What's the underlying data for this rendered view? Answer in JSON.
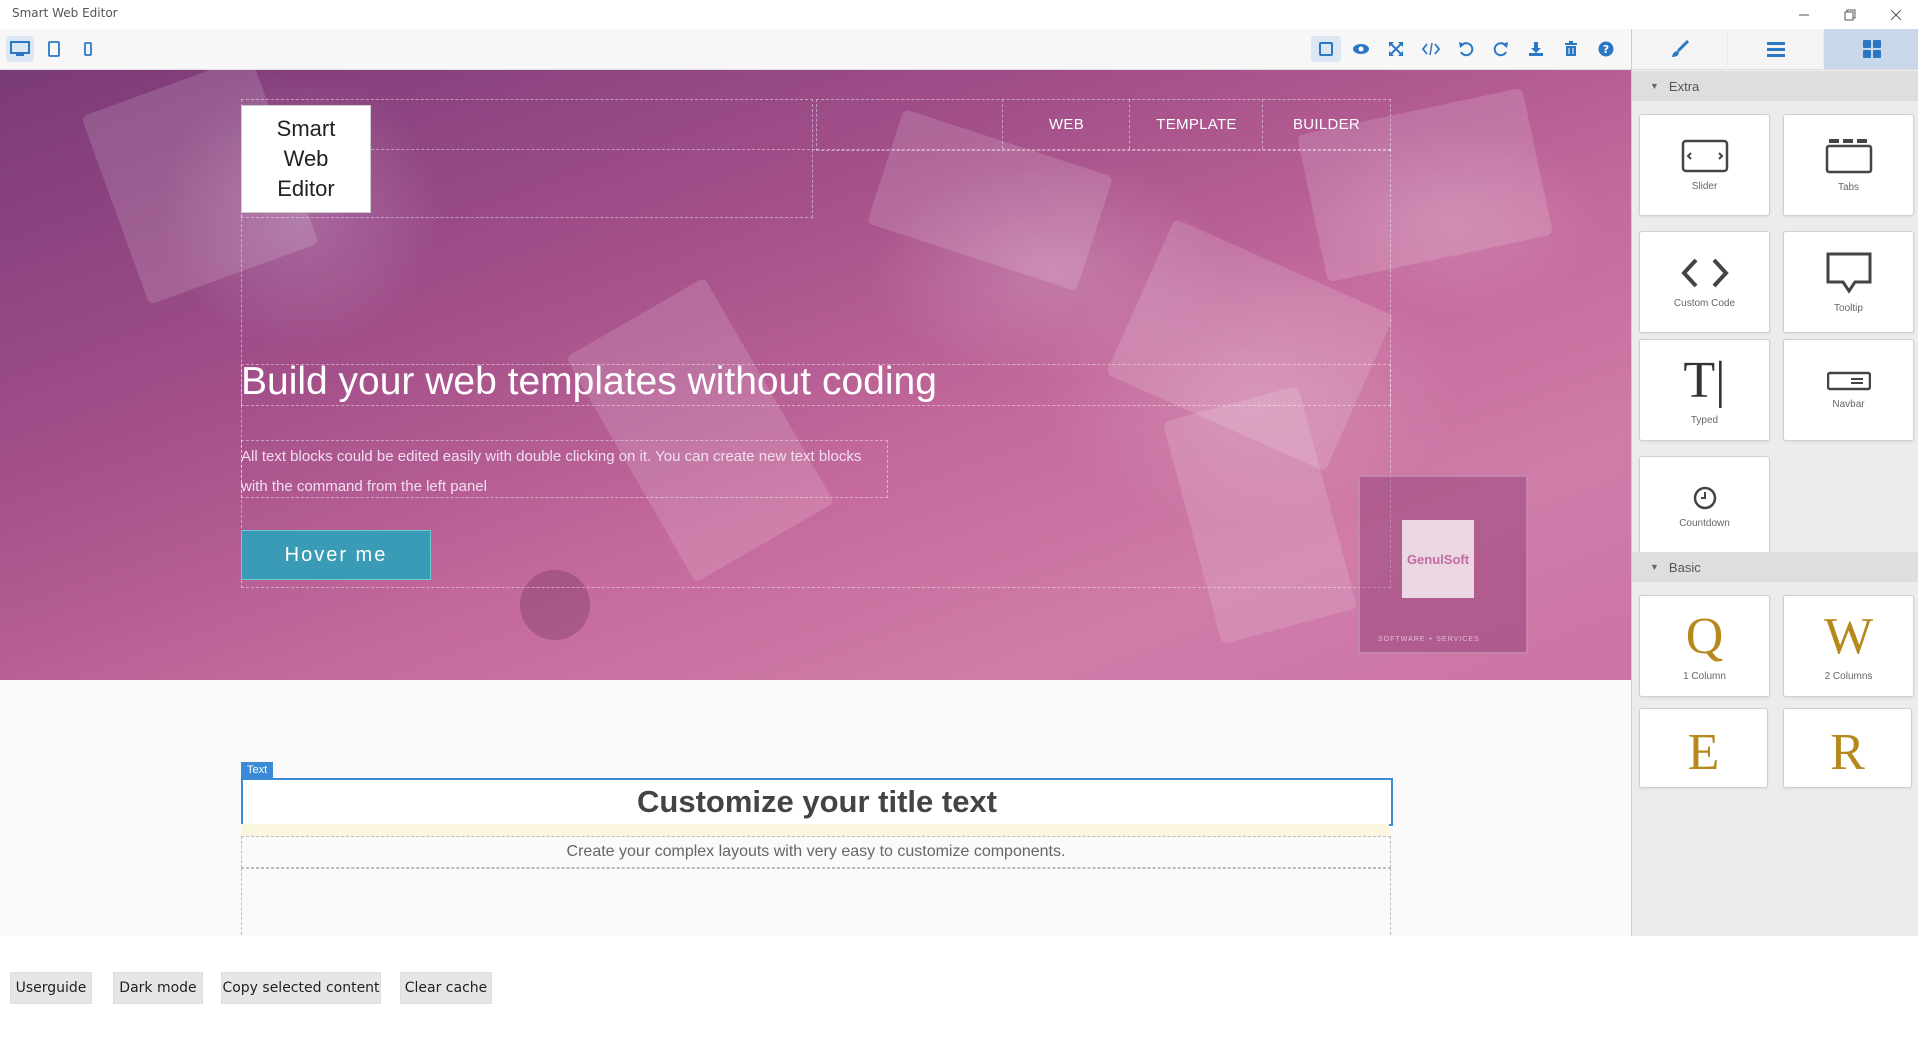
{
  "window": {
    "title": "Smart Web Editor"
  },
  "canvas": {
    "logo_line1": "Smart",
    "logo_line2": "Web",
    "logo_line3": "Editor",
    "nav": [
      "WEB",
      "TEMPLATE",
      "BUILDER"
    ],
    "hero_title": "Build your web templates without coding",
    "hero_desc": "All text blocks could be edited easily with double clicking on it. You can create new text blocks with the command from the left panel",
    "hero_button": "Hover me",
    "badge_text": "GenulSoft",
    "badge_caption": "SOFTWARE + SERVICES",
    "selected_label": "Text",
    "section_title": "Customize your title text",
    "section_subtitle": "Create your complex layouts with very easy to customize components."
  },
  "panel": {
    "categories": {
      "extra": "Extra",
      "basic": "Basic"
    },
    "extra_blocks": [
      "Slider",
      "Tabs",
      "Custom Code",
      "Tooltip",
      "Typed",
      "Navbar",
      "Countdown"
    ],
    "basic_blocks": [
      {
        "letter": "Q",
        "label": "1 Column"
      },
      {
        "letter": "W",
        "label": "2 Columns"
      },
      {
        "letter": "E",
        "label": ""
      },
      {
        "letter": "R",
        "label": ""
      }
    ],
    "typed_glyph": "T|"
  },
  "bottom": {
    "buttons": [
      "Userguide",
      "Dark mode",
      "Copy selected content",
      "Clear cache"
    ]
  },
  "colors": {
    "accent_blue": "#3b8bd6",
    "hero_button": "#3a9bb6",
    "block_gold": "#b5891b"
  }
}
